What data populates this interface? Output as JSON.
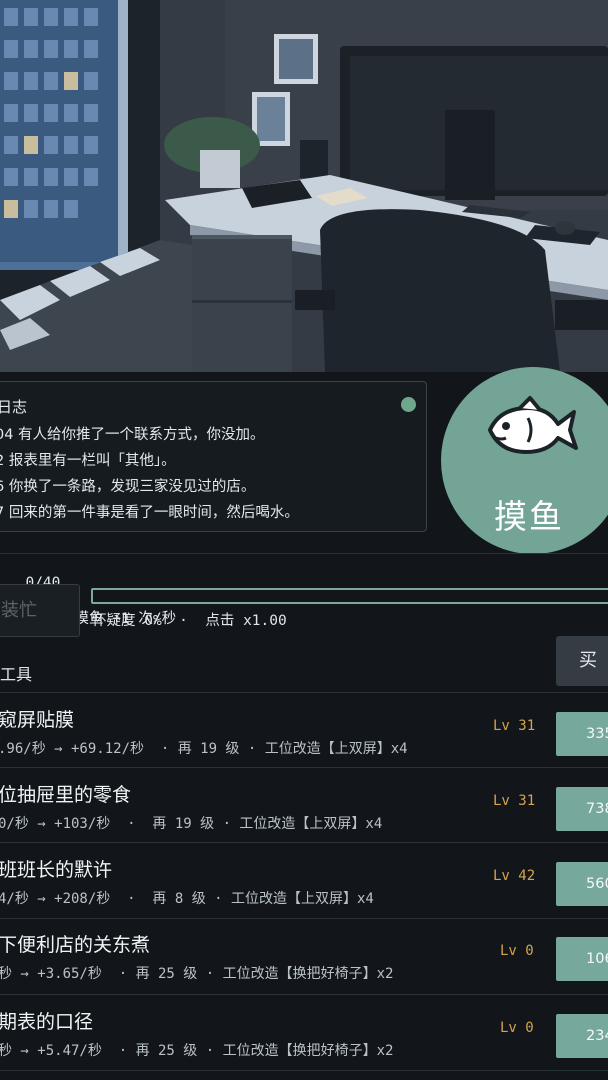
{
  "log": {
    "title": "日志",
    "lines": [
      "04 有人给你推了一个联系方式，你没加。",
      "2 报表里有一栏叫「其他」。",
      "6 你换了一条路，发现三家没见过的店。",
      "7 回来的第一件事是看了一眼时间，然后喝水。"
    ]
  },
  "fish_button": {
    "label": "摸鱼",
    "icon": "fish-icon"
  },
  "stats": {
    "count": "0/40",
    "separator": "|",
    "auto": "自动摸鱼 +1 次/秒"
  },
  "pretend_busy": {
    "label": "装忙"
  },
  "suspicion": {
    "text": "怀疑度 0%  ·  点击 x1.00",
    "value_percent": 0
  },
  "tools": {
    "title": "工具",
    "buy_label": "买",
    "items": [
      {
        "name": "窥屏贴膜",
        "detail": ".96/秒 → +69.12/秒  · 再 19 级 · 工位改造【上双屏】x4",
        "level": "Lv 31",
        "price": "335"
      },
      {
        "name": "位抽屉里的零食",
        "detail": "0/秒 → +103/秒  ·  再 19 级 · 工位改造【上双屏】x4",
        "level": "Lv 31",
        "price": "738"
      },
      {
        "name": "班班长的默许",
        "detail": "4/秒 → +208/秒  ·  再 8 级 · 工位改造【上双屏】x4",
        "level": "Lv 42",
        "price": "560"
      },
      {
        "name": "下便利店的关东煮",
        "detail": "秒 → +3.65/秒  · 再 25 级 · 工位改造【换把好椅子】x2",
        "level": "Lv 0",
        "price": "106"
      },
      {
        "name": "期表的口径",
        "detail": "秒 → +5.47/秒  · 再 25 级 · 工位改造【换把好椅子】x2",
        "level": "Lv 0",
        "price": "234"
      }
    ]
  },
  "colors": {
    "accent": "#73a496",
    "level": "#d6a44a",
    "background": "#12161b"
  }
}
